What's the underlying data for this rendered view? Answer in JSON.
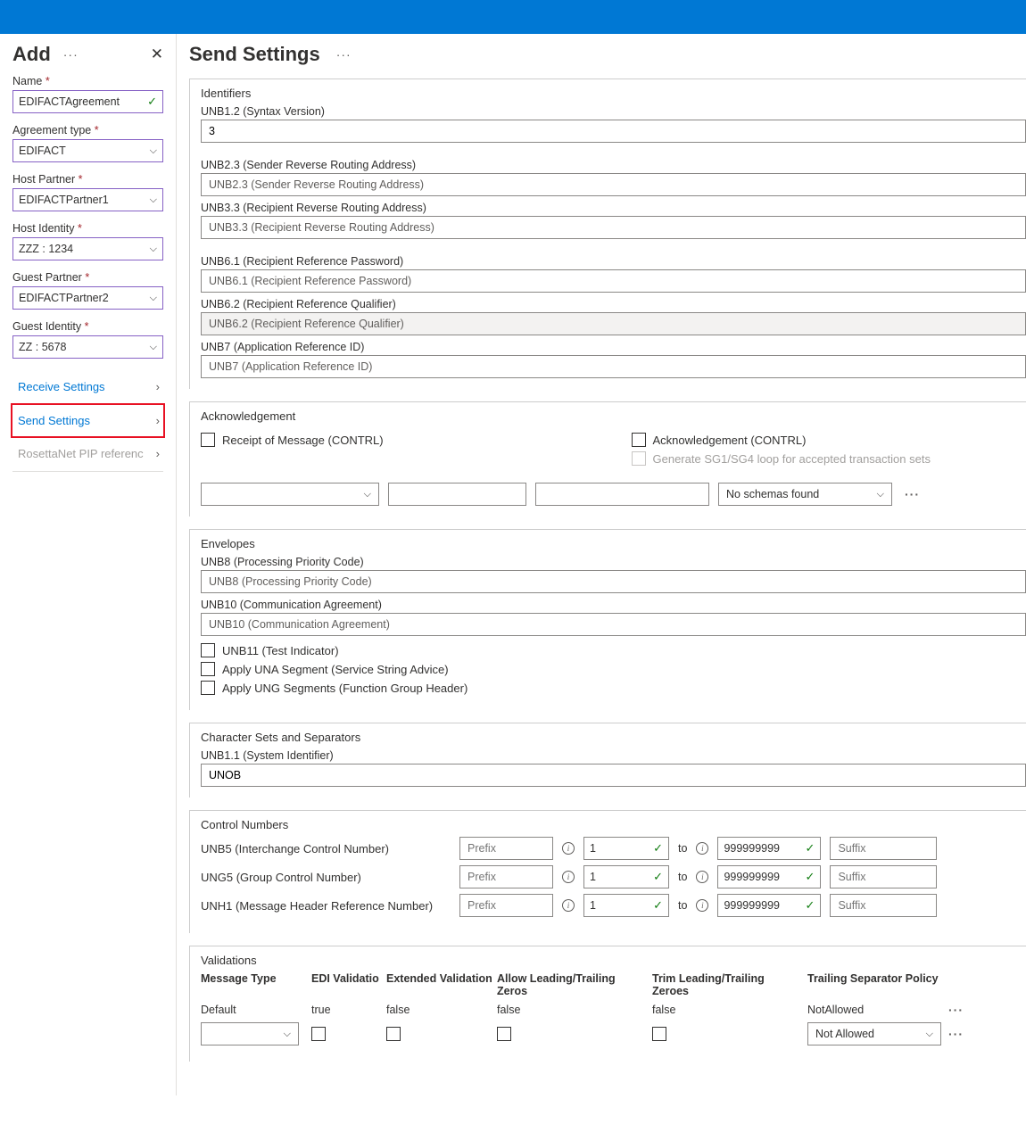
{
  "left": {
    "title": "Add",
    "name_label": "Name",
    "name_value": "EDIFACTAgreement",
    "agreement_type_label": "Agreement type",
    "agreement_type_value": "EDIFACT",
    "host_partner_label": "Host Partner",
    "host_partner_value": "EDIFACTPartner1",
    "host_identity_label": "Host Identity",
    "host_identity_value": "ZZZ : 1234",
    "guest_partner_label": "Guest Partner",
    "guest_partner_value": "EDIFACTPartner2",
    "guest_identity_label": "Guest Identity",
    "guest_identity_value": "ZZ : 5678",
    "nav_receive": "Receive Settings",
    "nav_send": "Send Settings",
    "nav_rosetta": "RosettaNet PIP referenc"
  },
  "main": {
    "title": "Send Settings",
    "identifiers": {
      "title": "Identifiers",
      "unb12_label": "UNB1.2 (Syntax Version)",
      "unb12_value": "3",
      "unb23_label": "UNB2.3 (Sender Reverse Routing Address)",
      "unb23_ph": "UNB2.3 (Sender Reverse Routing Address)",
      "unb33_label": "UNB3.3 (Recipient Reverse Routing Address)",
      "unb33_ph": "UNB3.3 (Recipient Reverse Routing Address)",
      "unb61_label": "UNB6.1 (Recipient Reference Password)",
      "unb61_ph": "UNB6.1 (Recipient Reference Password)",
      "unb62_label": "UNB6.2 (Recipient Reference Qualifier)",
      "unb62_ph": "UNB6.2 (Recipient Reference Qualifier)",
      "unb7_label": "UNB7 (Application Reference ID)",
      "unb7_ph": "UNB7 (Application Reference ID)"
    },
    "ack": {
      "title": "Acknowledgement",
      "receipt": "Receipt of Message (CONTRL)",
      "ack_contrl": "Acknowledgement (CONTRL)",
      "generate": "Generate SG1/SG4 loop for accepted transaction sets",
      "no_schemas": "No schemas found"
    },
    "env": {
      "title": "Envelopes",
      "unb8_label": "UNB8 (Processing Priority Code)",
      "unb8_ph": "UNB8 (Processing Priority Code)",
      "unb10_label": "UNB10 (Communication Agreement)",
      "unb10_ph": "UNB10 (Communication Agreement)",
      "unb11": "UNB11 (Test Indicator)",
      "una": "Apply UNA Segment (Service String Advice)",
      "ung": "Apply UNG Segments (Function Group Header)"
    },
    "charset": {
      "title": "Character Sets and Separators",
      "unb11_label": "UNB1.1 (System Identifier)",
      "unb11_value": "UNOB"
    },
    "ctrl": {
      "title": "Control Numbers",
      "unb5": "UNB5 (Interchange Control Number)",
      "ung5": "UNG5 (Group Control Number)",
      "unh1": "UNH1 (Message Header Reference Number)",
      "prefix_ph": "Prefix",
      "from": "1",
      "to_label": "to",
      "to_val": "999999999",
      "suffix_ph": "Suffix"
    },
    "val": {
      "title": "Validations",
      "h_msg": "Message Type",
      "h_edi": "EDI Validatio",
      "h_ext": "Extended Validation",
      "h_lead": "Allow Leading/Trailing Zeros",
      "h_trim": "Trim Leading/Trailing Zeroes",
      "h_trail": "Trailing Separator Policy",
      "r_default": "Default",
      "r_true": "true",
      "r_false": "false",
      "r_notallowed": "NotAllowed",
      "sel_notallowed": "Not Allowed"
    }
  }
}
